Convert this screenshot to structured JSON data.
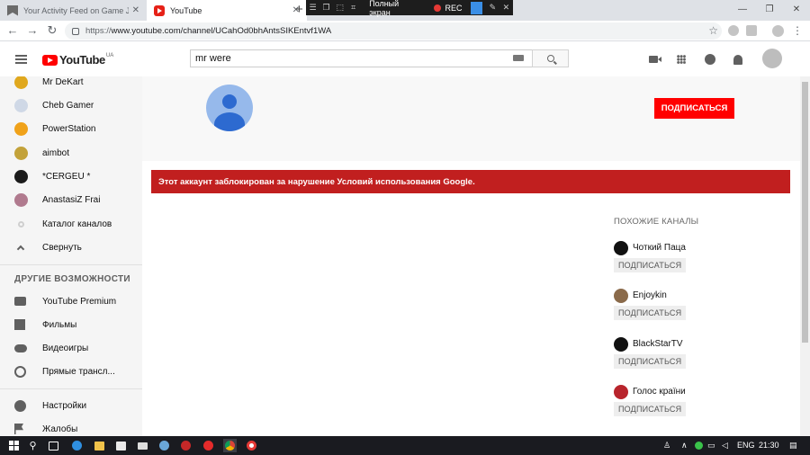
{
  "browser": {
    "tabs": [
      {
        "title": "Your Activity Feed on Game Jolt",
        "close": "✕"
      },
      {
        "title": "YouTube",
        "close": "✕"
      }
    ],
    "new_tab": "+",
    "url_prefix": "https://",
    "url_rest": "www.youtube.com/channel/UCahOd0bhAntsSIKEntvf1WA",
    "window_controls": [
      "—",
      "❐",
      "✕"
    ]
  },
  "recorder": {
    "fullscreen_label": "Полный экран",
    "rec_label": "REC"
  },
  "youtube": {
    "logo_text": "YouTube",
    "logo_region": "UA",
    "search_value": "mr were"
  },
  "sidebar": {
    "subscriptions": [
      {
        "label": "Mr DeKart",
        "color": "#e0a81e"
      },
      {
        "label": "Cheb Gamer",
        "color": "#cfd8e6"
      },
      {
        "label": "PowerStation",
        "color": "#f0a21a"
      },
      {
        "label": "aimbot",
        "color": "#c3a23a"
      },
      {
        "label": "*CERGEU *",
        "color": "#1b1b1b"
      },
      {
        "label": "AnastasiZ Frai",
        "color": "#b07a8e"
      },
      {
        "label": "Каталог каналов",
        "color": "#cfcfcf"
      },
      {
        "label": "Свернуть",
        "color": "#606060"
      }
    ],
    "more_heading": "ДРУГИЕ ВОЗМОЖНОСТИ",
    "more": [
      {
        "label": "YouTube Premium"
      },
      {
        "label": "Фильмы"
      },
      {
        "label": "Видеоигры"
      },
      {
        "label": "Прямые трансл..."
      }
    ],
    "settings": [
      {
        "label": "Настройки"
      },
      {
        "label": "Жалобы"
      }
    ]
  },
  "channel": {
    "subscribe_label": "ПОДПИСАТЬСЯ",
    "alert": "Этот аккаунт заблокирован за нарушение Условий использования Google."
  },
  "related": {
    "title": "ПОХОЖИЕ КАНАЛЫ",
    "items": [
      {
        "name": "Чоткий Паца",
        "subscribe": "ПОДПИСАТЬСЯ",
        "color": "#111111"
      },
      {
        "name": "Enjoykin",
        "subscribe": "ПОДПИСАТЬСЯ",
        "color": "#8a6a4a"
      },
      {
        "name": "BlackStarTV",
        "subscribe": "ПОДПИСАТЬСЯ",
        "color": "#111111"
      },
      {
        "name": "Голос країни",
        "subscribe": "ПОДПИСАТЬСЯ",
        "color": "#b8242c"
      }
    ]
  },
  "taskbar": {
    "lang": "ENG",
    "time": "21:30"
  },
  "colors": {
    "brand_red": "#ff0000",
    "alert_red": "#c11f1f",
    "sidebar_bg": "#f5f5f5"
  }
}
